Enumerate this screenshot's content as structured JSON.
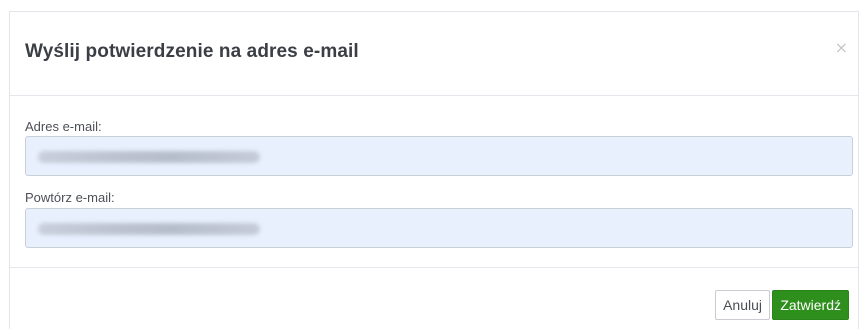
{
  "modal": {
    "title": "Wyślij potwierdzenie na adres e-mail",
    "close_icon": "×"
  },
  "form": {
    "email_label": "Adres e-mail:",
    "email_value_obscured": true,
    "repeat_email_label": "Powtórz e-mail:",
    "repeat_email_value_obscured": true
  },
  "footer": {
    "cancel_label": "Anuluj",
    "submit_label": "Zatwierdź"
  },
  "colors": {
    "submit_bg": "#2e8f1c",
    "input_bg": "#e8f0fe"
  },
  "icons": {
    "close": "close-icon"
  }
}
